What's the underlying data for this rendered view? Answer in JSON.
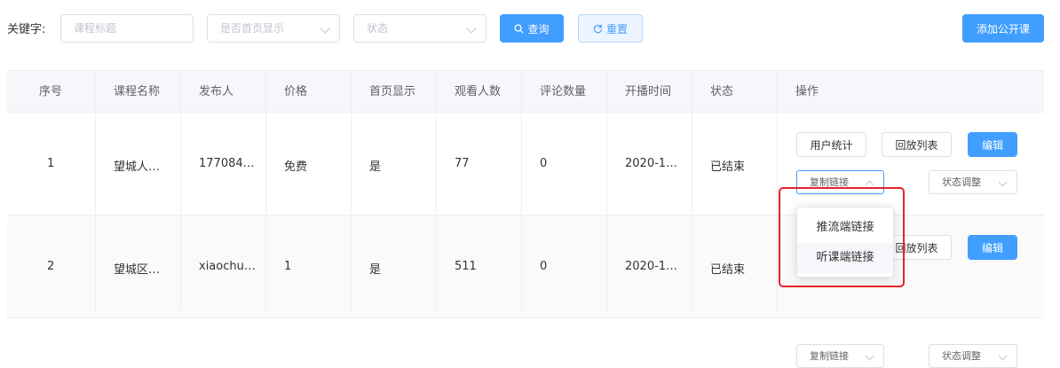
{
  "filters": {
    "keyword_label": "关键字:",
    "title_placeholder": "课程标题",
    "homepage_placeholder": "是否首页显示",
    "status_placeholder": "状态",
    "query_label": "查询",
    "reset_label": "重置",
    "add_label": "添加公开课"
  },
  "table": {
    "headers": [
      "序号",
      "课程名称",
      "发布人",
      "价格",
      "首页显示",
      "观看人数",
      "评论数量",
      "开播时间",
      "状态",
      "操作"
    ],
    "rows": [
      {
        "index": "1",
        "name": "望城人…",
        "publisher": "177084…",
        "price": "免费",
        "homepage": "是",
        "views": "77",
        "comments": "0",
        "time": "2020-1…",
        "status": "已结束"
      },
      {
        "index": "2",
        "name": "望城区…",
        "publisher": "xiaochu…",
        "price": "1",
        "homepage": "是",
        "views": "511",
        "comments": "0",
        "time": "2020-1…",
        "status": "已结束"
      }
    ],
    "actions": {
      "user_stats": "用户统计",
      "playback_list": "回放列表",
      "edit": "编辑",
      "copy_link": "复制链接",
      "status_adjust": "状态调整"
    }
  },
  "dropdown": {
    "items": [
      "推流端链接",
      "听课端链接"
    ]
  },
  "colors": {
    "primary": "#409eff",
    "highlight": "#e5242b"
  }
}
